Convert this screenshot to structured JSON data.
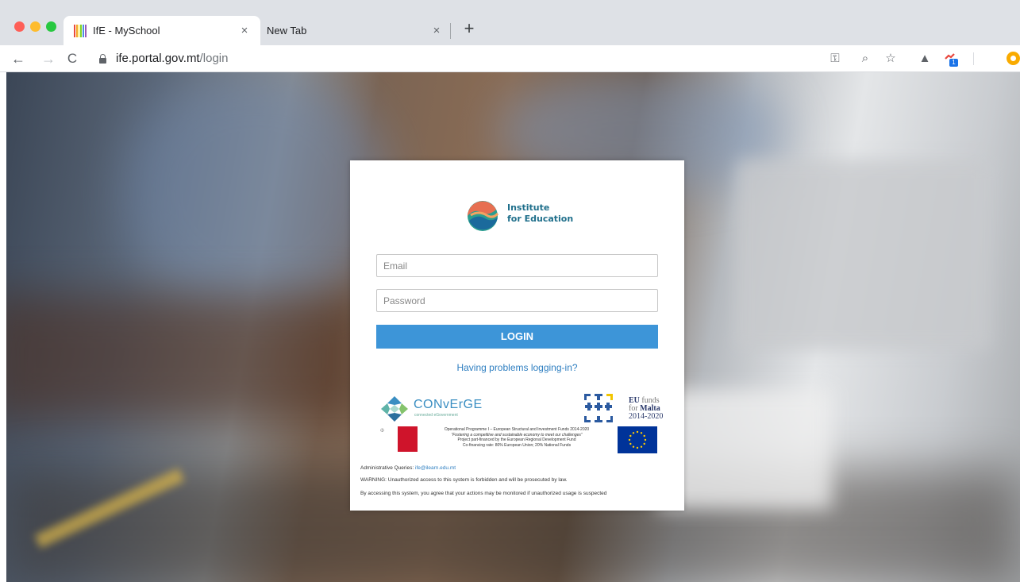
{
  "browser": {
    "tabs": [
      {
        "title": "IfE - MySchool",
        "active": true,
        "close": "×"
      },
      {
        "title": "New Tab",
        "active": false,
        "close": "×"
      }
    ],
    "new_tab_symbol": "+",
    "nav": {
      "back": "←",
      "forward": "→",
      "reload": "C"
    },
    "url": {
      "host": "ife.portal.gov.mt",
      "path": "/login"
    },
    "toolbar_icons": [
      "key-icon",
      "zoom-icon",
      "star-icon",
      "drive-icon",
      "extension-icon",
      "profile-icon"
    ],
    "extension_badge": "1",
    "glyphs": {
      "key": "⚿",
      "zoom": "⌕",
      "star": "☆",
      "drive": "▲"
    }
  },
  "login": {
    "logo_line1": "Institute",
    "logo_line2": "for Education",
    "email_placeholder": "Email",
    "password_placeholder": "Password",
    "login_button": "LOGIN",
    "help_link": "Having problems logging-in?"
  },
  "funding": {
    "converge_name": "CONvErGE",
    "converge_sub": "connected eGovernment",
    "eu_funds_line1_bold": "EU",
    "eu_funds_line1_rest": " funds",
    "eu_funds_line2_light": "for ",
    "eu_funds_line2_bold": "Malta",
    "eu_funds_line3": "2014-2020",
    "op_line1": "Operational Programme I – European Structural and Investment Funds 2014-2020",
    "op_line2": "“Fostering a competitive and sustainable economy to meet our challenges”",
    "op_line3": "Project part-financed by the European Regional Development Fund",
    "op_line4": "Co-financing rate: 80% European Union; 20% National Funds"
  },
  "footer": {
    "admin_label": "Administrative Queries: ",
    "admin_email": "ife@ilearn.edu.mt",
    "warning": "WARNING: Unauthorized access to this system is forbidden and will be prosecuted by law.",
    "monitor": "By accessing this system, you agree that your actions may be monitored if unauthorized usage is suspected"
  },
  "colors": {
    "login_button": "#3d95d8",
    "link": "#2f7fc1",
    "malta_red": "#cf142b",
    "eu_blue": "#003399"
  }
}
